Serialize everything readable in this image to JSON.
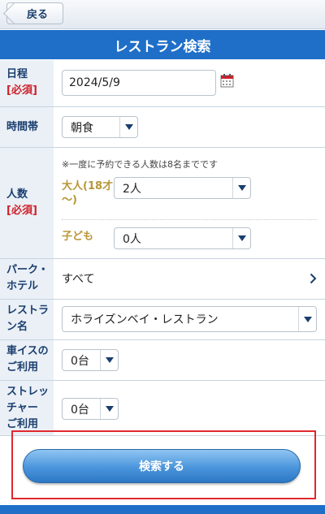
{
  "header": {
    "back_label": "戻る",
    "title": "レストラン検索"
  },
  "date": {
    "label": "日程",
    "required": "[必須]",
    "value": "2024/5/9",
    "icon": "calendar-icon"
  },
  "time_slot": {
    "label": "時間帯",
    "value": "朝食"
  },
  "party": {
    "label": "人数",
    "required": "[必須]",
    "note": "※一度に予約できる人数は8名までです",
    "adult_label_1": "大人(18才",
    "adult_label_2": "〜)",
    "adult_value": "2人",
    "child_label": "子ども",
    "child_value": "0人"
  },
  "park_hotel": {
    "label_1": "パーク・",
    "label_2": "ホテル",
    "value": "すべて"
  },
  "restaurant": {
    "label_1": "レストラ",
    "label_2": "ン名",
    "value": "ホライズンベイ・レストラン"
  },
  "wheelchair": {
    "label_1": "車イスの",
    "label_2": "ご利用",
    "value": "0台"
  },
  "stretcher": {
    "label_1": "ストレッ",
    "label_2": "チャー",
    "label_3": "ご利用",
    "value": "0台"
  },
  "search_button": "検索する",
  "colors": {
    "brand": "#1f6fc8",
    "required": "#d0202a",
    "label_bg": "#eaf0f6",
    "highlight": "#e0282e"
  }
}
